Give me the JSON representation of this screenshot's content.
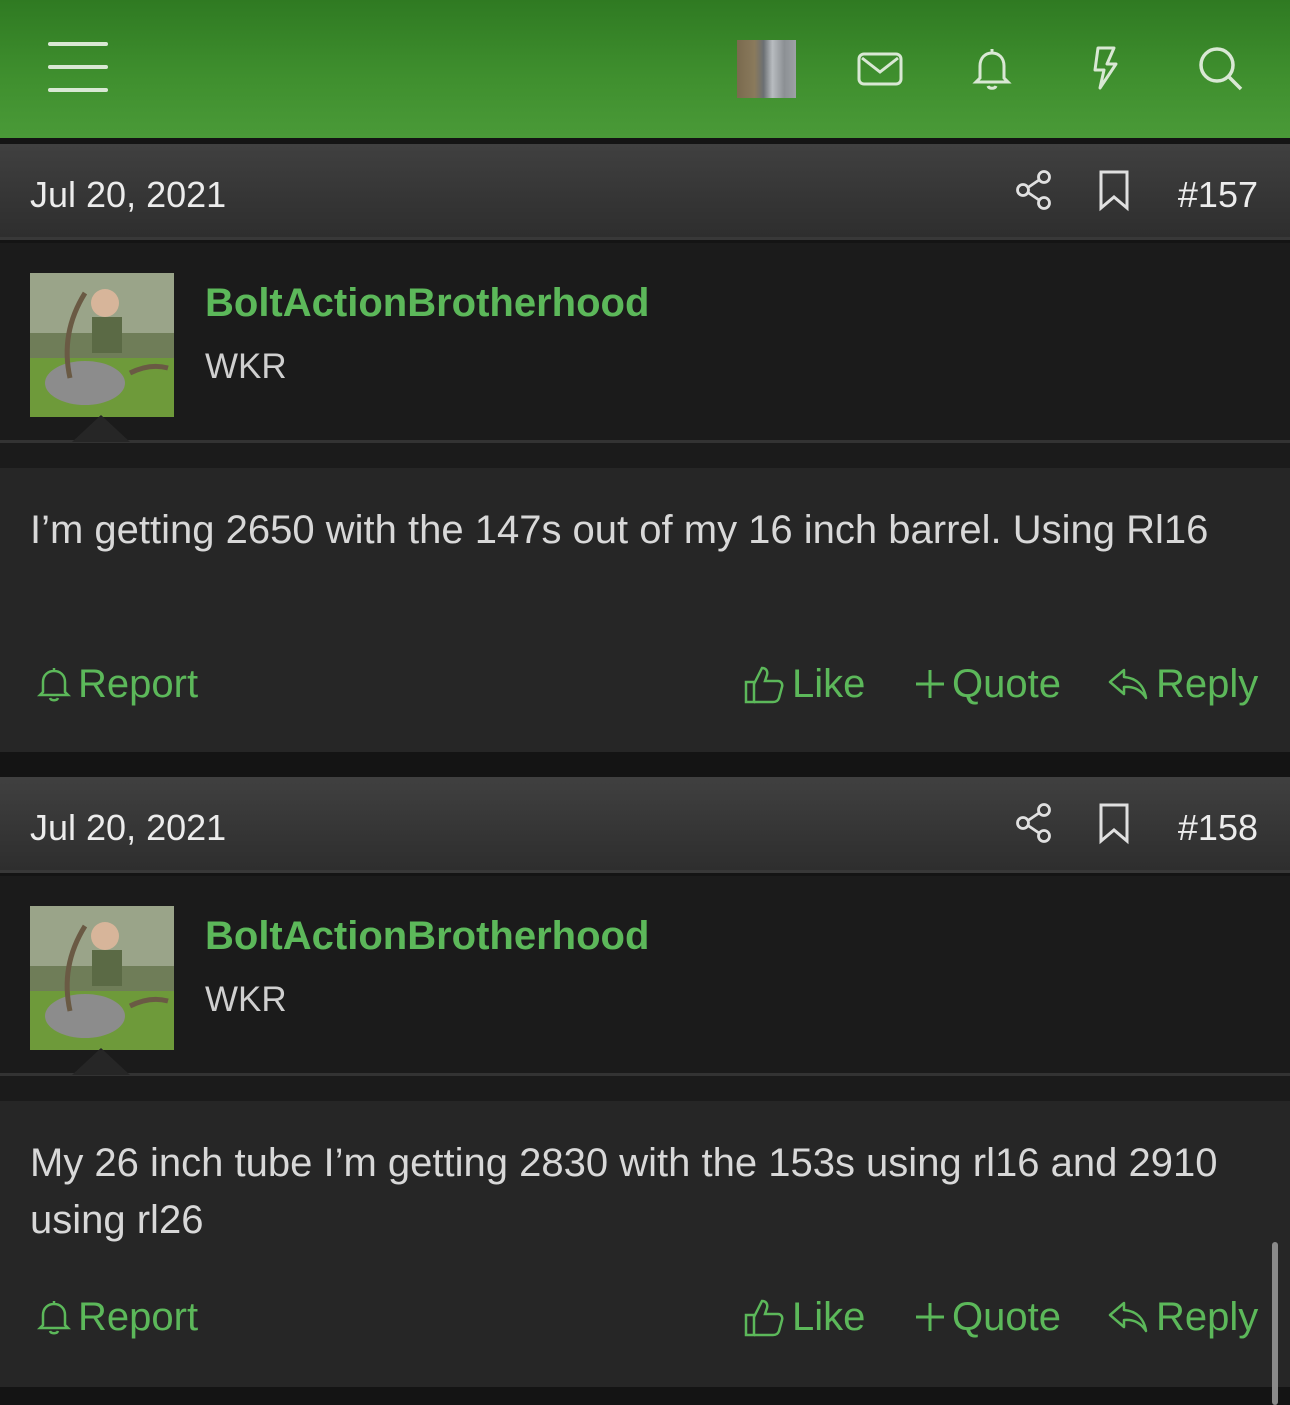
{
  "header": {
    "icons": [
      "menu-icon",
      "user-avatar",
      "envelope-icon",
      "bell-icon",
      "lightning-icon",
      "search-icon"
    ]
  },
  "posts": [
    {
      "date": "Jul 20, 2021",
      "number": "#157",
      "username": "BoltActionBrotherhood",
      "user_title": "WKR",
      "text": "I’m getting 2650 with the 147s out of my 16 inch barrel. Using Rl16",
      "actions": {
        "report": "Report",
        "like": "Like",
        "quote": "Quote",
        "reply": "Reply"
      }
    },
    {
      "date": "Jul 20, 2021",
      "number": "#158",
      "username": "BoltActionBrotherhood",
      "user_title": "WKR",
      "text": "My 26 inch tube I’m getting 2830 with the 153s using rl16 and 2910 using rl26",
      "actions": {
        "report": "Report",
        "like": "Like",
        "quote": "Quote",
        "reply": "Reply"
      }
    }
  ],
  "colors": {
    "header_green": "#3f8f2e",
    "accent_green": "#5cb85a",
    "post_bg": "#262626",
    "user_bg": "#1b1b1b"
  }
}
